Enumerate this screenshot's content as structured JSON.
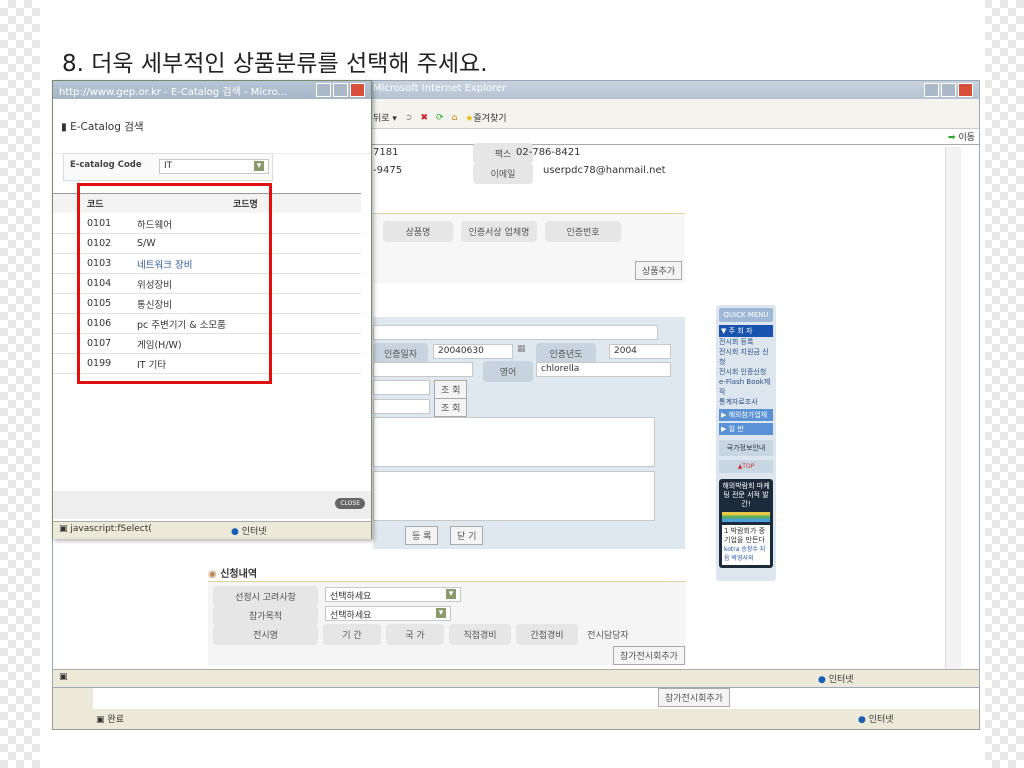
{
  "slide_title": "8. 더욱 세부적인 상품분류를 선택해 주세요.",
  "main_window": {
    "title": "Microsoft Internet Explorer",
    "toolbar": {
      "back": "뒤로",
      "favorites": "즐겨찾기",
      "go": "이동"
    },
    "contact": {
      "phone1": "7181",
      "phone2": "-9475",
      "fax_label": "팩스",
      "fax": "02-786-8421",
      "email_label": "이메일",
      "email": "userpdc78@hanmail.net"
    },
    "cert_headers": [
      "상품명",
      "인증서상 업체명",
      "인증번호"
    ],
    "add_product": "상품추가",
    "form": {
      "cert_date_label": "인증일자",
      "cert_date": "20040630",
      "cert_year_label": "인증년도",
      "cert_year": "2004",
      "english_label": "영어",
      "english": "chlorella",
      "lookup": "조 회",
      "register": "등 록",
      "close": "닫 기"
    },
    "application": {
      "title": "신청내역",
      "consider_label": "선정시 고려사항",
      "purpose_label": "참가목적",
      "select_placeholder": "선택하세요",
      "columns": [
        "전시명",
        "기 간",
        "국 가",
        "직접경비",
        "간접경비",
        "전시담당자"
      ],
      "add_exhibition": "참가전시회추가"
    },
    "quick_menu": {
      "title": "QUICK MENU",
      "section1": "▼ 주 최 자",
      "links": [
        "전시회 등록",
        "전시회 지원금 신청",
        "전시회 인증신청",
        "e-Flash Book제작",
        "통계자료조사"
      ],
      "section2": "▶ 해외참가업체",
      "section3": "▶ 일 반",
      "national": "국가정보안내",
      "top": "▲TOP",
      "banner_title": "해외박람회 마케팅 전문 서적 발간!",
      "banner_book": "1 박람회가 중기업을 만든다",
      "banner_pub": "kotra 송창수 지음 박영사외"
    },
    "status_zone": "인터넷"
  },
  "back_window": {
    "add_exhibition": "참가전시회추가",
    "status": "완료",
    "zone": "인터넷"
  },
  "popup": {
    "title": "http://www.gep.or.kr - E-Catalog 검색 - Micro...",
    "heading": "E-Catalog 검색",
    "code_label": "E-catalog Code",
    "code_value": "IT",
    "col_code": "코드",
    "col_name": "코드명",
    "rows": [
      {
        "code": "0101",
        "name": "하드웨어"
      },
      {
        "code": "0102",
        "name": "S/W"
      },
      {
        "code": "0103",
        "name": "네트워크 장비"
      },
      {
        "code": "0104",
        "name": "위성장비"
      },
      {
        "code": "0105",
        "name": "통신장비"
      },
      {
        "code": "0106",
        "name": "pc 주변기기 & 소모품"
      },
      {
        "code": "0107",
        "name": "게임(H/W)"
      },
      {
        "code": "0199",
        "name": "IT 기타"
      }
    ],
    "close": "CLOSE",
    "status": "javascript:fSelect(",
    "zone": "인터넷"
  },
  "colors": {
    "highlight": "#e01010",
    "link": "#2a5a9a"
  }
}
